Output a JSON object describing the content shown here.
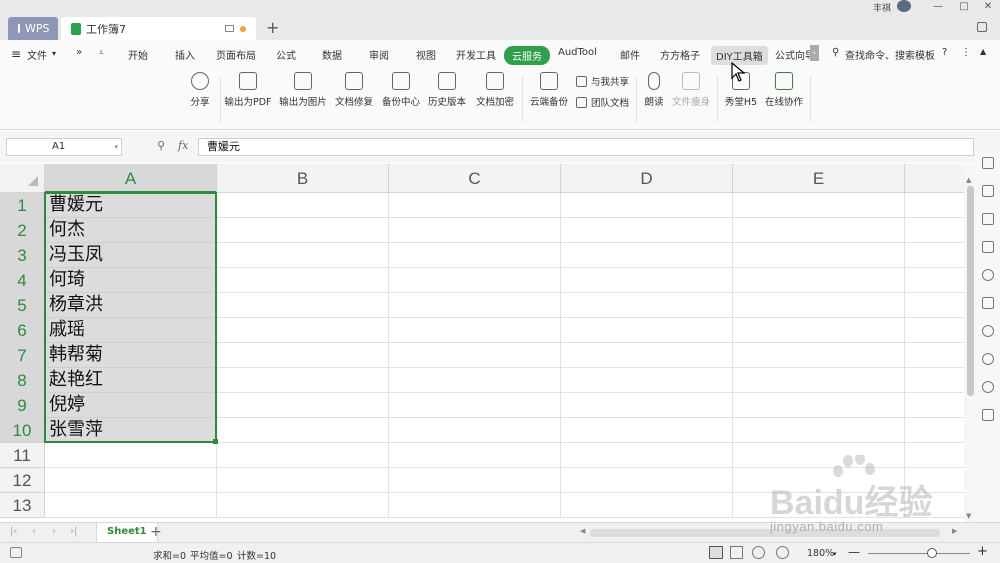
{
  "titlebar": {
    "wps_tab": "WPS",
    "doc_tab": "工作簿7",
    "new_tab": "+",
    "user_name": "丰祺"
  },
  "menubar": {
    "file": "文件",
    "more_left": "»",
    "items": [
      "开始",
      "插入",
      "页面布局",
      "公式",
      "数据",
      "审阅",
      "视图",
      "开发工具",
      "云服务",
      "AudTool",
      "邮件",
      "方方格子",
      "DIY工具箱",
      "公式向导"
    ],
    "active_item": "云服务",
    "hover_item": "DIY工具箱",
    "search": "查找命令、搜索模板"
  },
  "toolbar": {
    "share": "分享",
    "export_pdf": "输出为PDF",
    "export_image": "输出为图片",
    "doc_repair": "文档修复",
    "backup_center": "备份中心",
    "history": "历史版本",
    "doc_encrypt": "文档加密",
    "cloud_backup": "云端备份",
    "shared_with_me": "与我共享",
    "team_docs": "团队文档",
    "read_aloud": "朗读",
    "doc_slim": "文件瘦身",
    "show_h5": "秀堂H5",
    "online_collab": "在线协作"
  },
  "formula_bar": {
    "name_box": "A1",
    "fx": "fx",
    "value": "曹媛元"
  },
  "grid": {
    "columns": [
      "A",
      "B",
      "C",
      "D",
      "E"
    ],
    "rows": [
      "1",
      "2",
      "3",
      "4",
      "5",
      "6",
      "7",
      "8",
      "9",
      "10",
      "11",
      "12",
      "13"
    ],
    "column_a_values": [
      "曹媛元",
      "何杰",
      "冯玉凤",
      "何琦",
      "杨章洪",
      "戚瑶",
      "韩帮菊",
      "赵艳红",
      "倪婷",
      "张雪萍"
    ]
  },
  "sheet_tabs": {
    "sheet1": "Sheet1",
    "add": "+"
  },
  "status_bar": {
    "sum": "求和=0",
    "average": "平均值=0",
    "count": "计数=10",
    "zoom": "180%"
  },
  "watermark": {
    "brand": "Baidu经验",
    "url": "jingyan.baidu.com"
  },
  "colors": {
    "accent_green": "#2e8b3d",
    "cloud_tab": "#2ea04a"
  }
}
